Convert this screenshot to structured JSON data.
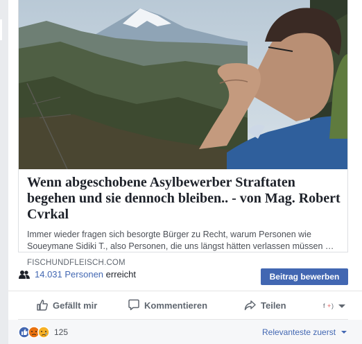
{
  "link_preview": {
    "title": "Wenn abgeschobene Asylbewerber Straftaten begehen und sie dennoch bleiben.. - von Mag. Robert Cvrkal",
    "description": "Immer wieder fragen sich besorgte Bürger zu Recht, warum Personen wie Soueymane Sidiki T., also Personen, die uns längst hätten verlassen müssen …",
    "domain": "FISCHUNDFLEISCH.COM"
  },
  "reach": {
    "count": "14.031 Personen",
    "suffix": " erreicht",
    "boost_label": "Beitrag bewerben"
  },
  "actions": {
    "like": "Gefällt mir",
    "comment": "Kommentieren",
    "share": "Teilen"
  },
  "reactions": {
    "count": "125",
    "sort_label": "Relevanteste zuerst",
    "colors": {
      "like": "#4267b2",
      "angry": "#e9710f",
      "sad": "#f7b125"
    }
  },
  "colors": {
    "accent": "#4267b2",
    "text": "#1d2129",
    "secondary_text": "#606770"
  }
}
